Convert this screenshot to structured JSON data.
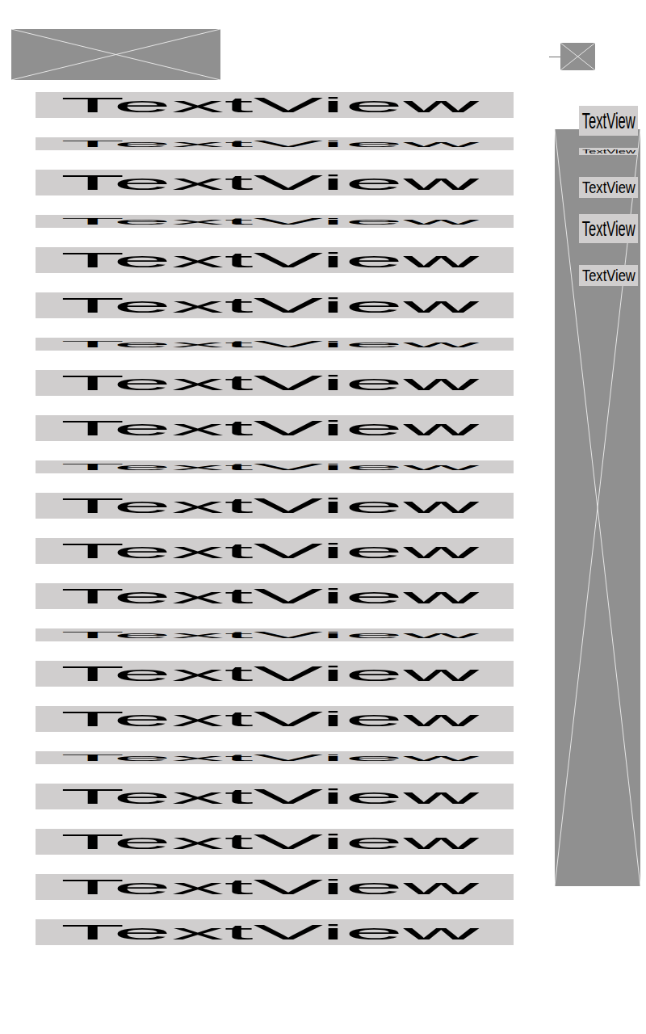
{
  "left_column": {
    "text_views": [
      {
        "text": "TextView",
        "kind": "large"
      },
      {
        "text": "TextView",
        "kind": "small"
      },
      {
        "text": "TextView",
        "kind": "large"
      },
      {
        "text": "TextView",
        "kind": "small"
      },
      {
        "text": "TextView",
        "kind": "large"
      },
      {
        "text": "TextView",
        "kind": "large"
      },
      {
        "text": "TextView",
        "kind": "small"
      },
      {
        "text": "TextView",
        "kind": "large"
      },
      {
        "text": "TextView",
        "kind": "large"
      },
      {
        "text": "TextView",
        "kind": "small"
      },
      {
        "text": "TextView",
        "kind": "large"
      },
      {
        "text": "TextView",
        "kind": "large"
      },
      {
        "text": "TextView",
        "kind": "large"
      },
      {
        "text": "TextView",
        "kind": "small"
      },
      {
        "text": "TextView",
        "kind": "large"
      },
      {
        "text": "TextView",
        "kind": "large"
      },
      {
        "text": "TextView",
        "kind": "small"
      },
      {
        "text": "TextView",
        "kind": "large"
      },
      {
        "text": "TextView",
        "kind": "large"
      },
      {
        "text": "TextView",
        "kind": "large"
      },
      {
        "text": "TextView",
        "kind": "large"
      }
    ]
  },
  "right_column": {
    "text_views": [
      {
        "text": "TextView",
        "kind": "xl"
      },
      {
        "text": "TextView",
        "kind": "tiny"
      },
      {
        "text": "TextView",
        "kind": "medium"
      },
      {
        "text": "TextView",
        "kind": "large"
      },
      {
        "text": "TextView",
        "kind": "medium"
      }
    ]
  }
}
